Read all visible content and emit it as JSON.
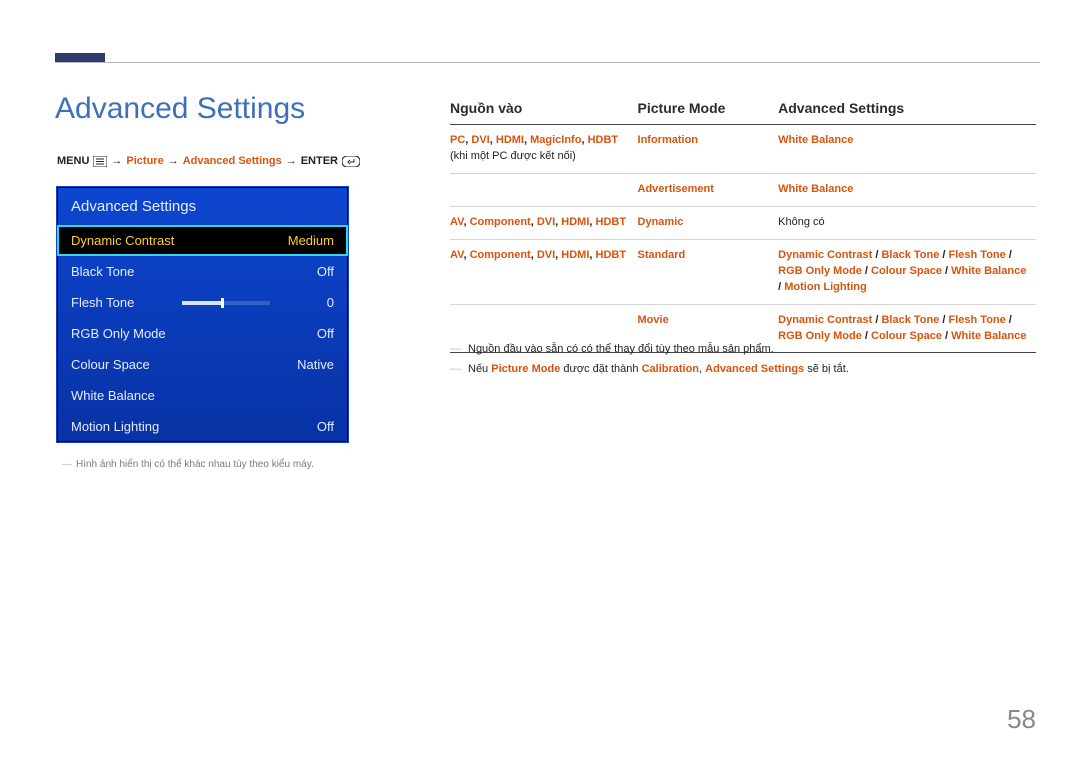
{
  "page": {
    "title": "Advanced Settings",
    "number": "58"
  },
  "breadcrumb": {
    "menu": "MENU",
    "picture": "Picture",
    "adv": "Advanced Settings",
    "enter": "ENTER",
    "arrow": "→"
  },
  "osd": {
    "title": "Advanced Settings",
    "rows": [
      {
        "label": "Dynamic Contrast",
        "value": "Medium",
        "selected": true
      },
      {
        "label": "Black Tone",
        "value": "Off"
      },
      {
        "label": "Flesh Tone",
        "value": "0",
        "slider": 0
      },
      {
        "label": "RGB Only Mode",
        "value": "Off"
      },
      {
        "label": "Colour Space",
        "value": "Native"
      },
      {
        "label": "White Balance",
        "value": ""
      },
      {
        "label": "Motion Lighting",
        "value": "Off"
      }
    ],
    "note": "Hình ảnh hiển thị có thể khác nhau tùy theo kiểu máy."
  },
  "table": {
    "headers": [
      "Nguồn vào",
      "Picture Mode",
      "Advanced Settings"
    ],
    "rows": [
      {
        "source_parts": [
          {
            "t": "PC",
            "c": "o"
          },
          {
            "t": ", ",
            "c": "k"
          },
          {
            "t": "DVI",
            "c": "o"
          },
          {
            "t": ", ",
            "c": "k"
          },
          {
            "t": "HDMI",
            "c": "o"
          },
          {
            "t": ", ",
            "c": "k"
          },
          {
            "t": "MagicInfo",
            "c": "o"
          },
          {
            "t": ", ",
            "c": "k"
          },
          {
            "t": "HDBT",
            "c": "o"
          },
          {
            "t": " (khi một PC được kết nối)",
            "c": "n"
          }
        ],
        "mode_parts": [
          {
            "t": "Information",
            "c": "o"
          }
        ],
        "settings_parts": [
          {
            "t": "White Balance",
            "c": "o"
          }
        ]
      },
      {
        "source_parts": [],
        "mode_parts": [
          {
            "t": "Advertisement",
            "c": "o"
          }
        ],
        "settings_parts": [
          {
            "t": "White Balance",
            "c": "o"
          }
        ]
      },
      {
        "source_parts": [
          {
            "t": "AV",
            "c": "o"
          },
          {
            "t": ", ",
            "c": "k"
          },
          {
            "t": "Component",
            "c": "o"
          },
          {
            "t": ", ",
            "c": "k"
          },
          {
            "t": "DVI",
            "c": "o"
          },
          {
            "t": ", ",
            "c": "k"
          },
          {
            "t": "HDMI",
            "c": "o"
          },
          {
            "t": ", ",
            "c": "k"
          },
          {
            "t": "HDBT",
            "c": "o"
          }
        ],
        "mode_parts": [
          {
            "t": "Dynamic",
            "c": "o"
          }
        ],
        "settings_parts": [
          {
            "t": "Không có",
            "c": "plain"
          }
        ]
      },
      {
        "source_parts": [
          {
            "t": "AV",
            "c": "o"
          },
          {
            "t": ", ",
            "c": "k"
          },
          {
            "t": "Component",
            "c": "o"
          },
          {
            "t": ", ",
            "c": "k"
          },
          {
            "t": "DVI",
            "c": "o"
          },
          {
            "t": ", ",
            "c": "k"
          },
          {
            "t": "HDMI",
            "c": "o"
          },
          {
            "t": ", ",
            "c": "k"
          },
          {
            "t": "HDBT",
            "c": "o"
          }
        ],
        "mode_parts": [
          {
            "t": "Standard",
            "c": "o"
          }
        ],
        "settings_parts": [
          {
            "t": "Dynamic Contrast",
            "c": "o"
          },
          {
            "t": " / ",
            "c": "k"
          },
          {
            "t": "Black Tone",
            "c": "o"
          },
          {
            "t": " / ",
            "c": "k"
          },
          {
            "t": "Flesh Tone",
            "c": "o"
          },
          {
            "t": " / ",
            "c": "k"
          },
          {
            "t": "RGB Only Mode",
            "c": "o"
          },
          {
            "t": " / ",
            "c": "k"
          },
          {
            "t": "Colour Space",
            "c": "o"
          },
          {
            "t": " / ",
            "c": "k"
          },
          {
            "t": "White Balance",
            "c": "o"
          },
          {
            "t": " / ",
            "c": "k"
          },
          {
            "t": "Motion Lighting",
            "c": "o"
          }
        ]
      },
      {
        "source_parts": [],
        "mode_parts": [
          {
            "t": "Movie",
            "c": "o"
          }
        ],
        "settings_parts": [
          {
            "t": "Dynamic Contrast",
            "c": "o"
          },
          {
            "t": " / ",
            "c": "k"
          },
          {
            "t": "Black Tone",
            "c": "o"
          },
          {
            "t": " / ",
            "c": "k"
          },
          {
            "t": "Flesh Tone",
            "c": "o"
          },
          {
            "t": " / ",
            "c": "k"
          },
          {
            "t": "RGB Only Mode",
            "c": "o"
          },
          {
            "t": " / ",
            "c": "k"
          },
          {
            "t": "Colour Space",
            "c": "o"
          },
          {
            "t": " / ",
            "c": "k"
          },
          {
            "t": "White Balance",
            "c": "o"
          }
        ]
      }
    ]
  },
  "notes": {
    "n1_parts": [
      {
        "t": "Nguồn đầu vào sẵn có có thể thay đổi tùy theo mẫu sản phẩm.",
        "c": "plain"
      }
    ],
    "n2_parts": [
      {
        "t": "Nếu ",
        "c": "plain"
      },
      {
        "t": "Picture Mode",
        "c": "o"
      },
      {
        "t": " được đặt thành ",
        "c": "plain"
      },
      {
        "t": "Calibration",
        "c": "o"
      },
      {
        "t": ", ",
        "c": "plain"
      },
      {
        "t": "Advanced Settings",
        "c": "o"
      },
      {
        "t": " sẽ bị tắt.",
        "c": "plain"
      }
    ]
  }
}
